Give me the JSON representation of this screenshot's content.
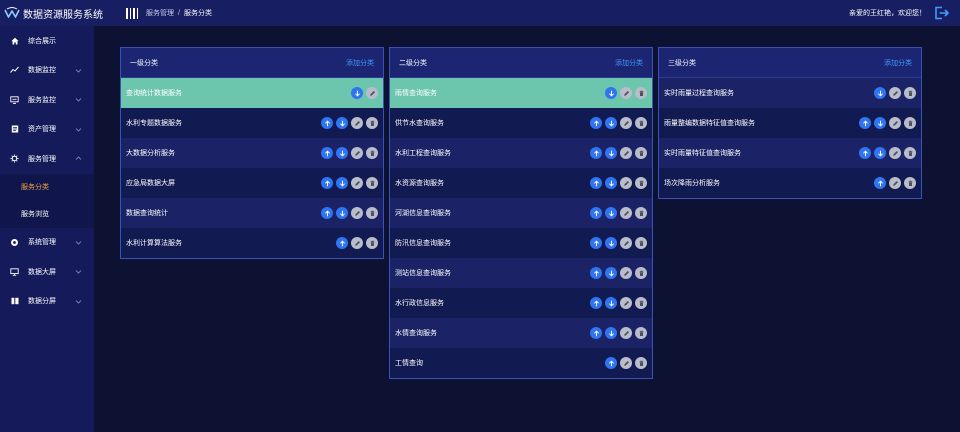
{
  "app": {
    "title": "数据资源服务系统"
  },
  "breadcrumb": {
    "parent": "服务管理",
    "separator": "/",
    "current": "服务分类"
  },
  "user": {
    "welcome": "亲爱的王红艳，欢迎您！"
  },
  "sidebar": {
    "items": [
      {
        "label": "综合展示",
        "icon": "home-icon",
        "expandable": false
      },
      {
        "label": "数据监控",
        "icon": "chart-line-icon",
        "expandable": true
      },
      {
        "label": "服务监控",
        "icon": "monitor-icon",
        "expandable": true
      },
      {
        "label": "资产管理",
        "icon": "document-icon",
        "expandable": true
      },
      {
        "label": "服务管理",
        "icon": "gear-icon",
        "expandable": true,
        "expanded": true
      },
      {
        "label": "系统管理",
        "icon": "settings-icon",
        "expandable": true
      },
      {
        "label": "数据大屏",
        "icon": "screen-icon",
        "expandable": true
      },
      {
        "label": "数据分屏",
        "icon": "split-icon",
        "expandable": true
      }
    ],
    "sub_items": [
      {
        "label": "服务分类",
        "active": true
      },
      {
        "label": "服务浏览",
        "active": false
      }
    ]
  },
  "panels": [
    {
      "title": "一级分类",
      "add_label": "添加分类",
      "rows": [
        {
          "label": "查询统计数据服务",
          "actions": [
            "down",
            "edit"
          ],
          "selected": true
        },
        {
          "label": "水利专题数据服务",
          "actions": [
            "up",
            "down",
            "edit",
            "delete"
          ]
        },
        {
          "label": "大数据分析服务",
          "actions": [
            "up",
            "down",
            "edit",
            "delete"
          ]
        },
        {
          "label": "应急局数据大屏",
          "actions": [
            "up",
            "down",
            "edit",
            "delete"
          ]
        },
        {
          "label": "数据查询统计",
          "actions": [
            "up",
            "down",
            "edit",
            "delete"
          ]
        },
        {
          "label": "水利计算算法服务",
          "actions": [
            "up",
            "edit",
            "delete"
          ]
        }
      ]
    },
    {
      "title": "二级分类",
      "add_label": "添加分类",
      "rows": [
        {
          "label": "雨情查询服务",
          "actions": [
            "down",
            "edit",
            "delete"
          ],
          "selected": true
        },
        {
          "label": "供节水查询服务",
          "actions": [
            "up",
            "down",
            "edit",
            "delete"
          ]
        },
        {
          "label": "水利工程查询服务",
          "actions": [
            "up",
            "down",
            "edit",
            "delete"
          ]
        },
        {
          "label": "水资源查询服务",
          "actions": [
            "up",
            "down",
            "edit",
            "delete"
          ]
        },
        {
          "label": "河湖信息查询服务",
          "actions": [
            "up",
            "down",
            "edit",
            "delete"
          ]
        },
        {
          "label": "防汛信息查询服务",
          "actions": [
            "up",
            "down",
            "edit",
            "delete"
          ]
        },
        {
          "label": "测站信息查询服务",
          "actions": [
            "up",
            "down",
            "edit",
            "delete"
          ]
        },
        {
          "label": "水行政信息服务",
          "actions": [
            "up",
            "down",
            "edit",
            "delete"
          ]
        },
        {
          "label": "水情查询服务",
          "actions": [
            "up",
            "down",
            "edit",
            "delete"
          ]
        },
        {
          "label": "工情查询",
          "actions": [
            "up",
            "edit",
            "delete"
          ]
        }
      ]
    },
    {
      "title": "三级分类",
      "add_label": "添加分类",
      "rows": [
        {
          "label": "实时雨量过程查询服务",
          "actions": [
            "down",
            "edit",
            "delete"
          ]
        },
        {
          "label": "雨量整编数据特征值查询服务",
          "actions": [
            "up",
            "down",
            "edit",
            "delete"
          ]
        },
        {
          "label": "实时雨量特征值查询服务",
          "actions": [
            "up",
            "down",
            "edit",
            "delete"
          ]
        },
        {
          "label": "场次降雨分析服务",
          "actions": [
            "up",
            "edit",
            "delete"
          ]
        }
      ]
    }
  ],
  "colors": {
    "accent": "#3f9bff",
    "selected_row": "#6cc5ad",
    "active_nav": "#f0a640",
    "move_button": "#2f74f0",
    "edit_button": "#b9bdc9"
  }
}
